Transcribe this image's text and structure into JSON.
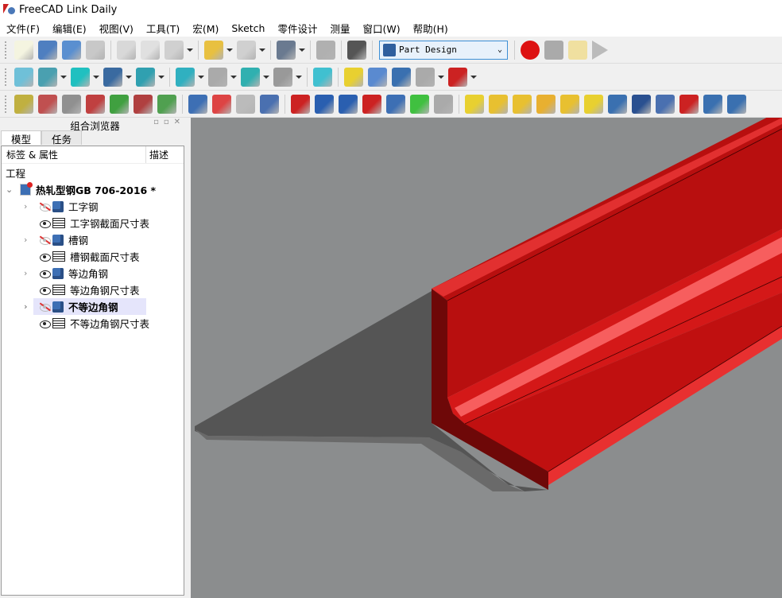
{
  "window": {
    "title": "FreeCAD Link Daily"
  },
  "menu": [
    "文件(F)",
    "编辑(E)",
    "视图(V)",
    "工具(T)",
    "宏(M)",
    "Sketch",
    "零件设计",
    "测量",
    "窗口(W)",
    "帮助(H)"
  ],
  "toolbar1": {
    "icons": [
      {
        "name": "new-file-icon",
        "color": "#f4f4e0"
      },
      {
        "name": "open-folder-icon",
        "color": "#4f7fc0"
      },
      {
        "name": "save-icon",
        "color": "#5a8fd0"
      },
      {
        "name": "print-icon",
        "color": "#c8c8c8"
      },
      {
        "name": "cut-icon",
        "color": "#d8d8d8"
      },
      {
        "name": "copy-icon",
        "color": "#e0e0e0"
      },
      {
        "name": "paste-icon",
        "color": "#d0d0d0"
      },
      {
        "name": "undo-icon",
        "color": "#e8c040"
      },
      {
        "name": "redo-icon",
        "color": "#d0d0d0"
      },
      {
        "name": "refresh-check-icon",
        "color": "#6a7a90"
      },
      {
        "name": "recompute-icon",
        "color": "#b0b0b0"
      },
      {
        "name": "whats-this-icon",
        "color": "#555"
      }
    ],
    "workbench": "Part Design",
    "macro_icons": [
      {
        "name": "record-macro-icon",
        "color": "#dd1111"
      },
      {
        "name": "stop-macro-icon",
        "color": "#aaaaaa"
      },
      {
        "name": "edit-macro-icon",
        "color": "#f0e0a0"
      },
      {
        "name": "run-macro-icon",
        "color": "#bbbbbb"
      }
    ]
  },
  "toolbar2": {
    "icons": [
      {
        "name": "fit-all-icon",
        "color": "#6fc0d8"
      },
      {
        "name": "isometric-view-icon",
        "color": "#4aa0b0"
      },
      {
        "name": "draw-style-icon",
        "color": "#20c0c0"
      },
      {
        "name": "box-selection-icon",
        "color": "#3a6aa0"
      },
      {
        "name": "zoom-selection-icon",
        "color": "#30a0b0"
      },
      {
        "name": "back-icon",
        "color": "#30b0c0"
      },
      {
        "name": "forward-icon",
        "color": "#aaaaaa"
      },
      {
        "name": "up-icon",
        "color": "#30b0b0"
      },
      {
        "name": "std-views-icon",
        "color": "#999999"
      },
      {
        "name": "measure-ruler-icon",
        "color": "#40c0d0"
      },
      {
        "name": "part-icon",
        "color": "#e8d030"
      },
      {
        "name": "group-icon",
        "color": "#5a8ad0"
      },
      {
        "name": "link-icon",
        "color": "#3a70b0"
      },
      {
        "name": "link-actions-icon",
        "color": "#aaaaaa"
      },
      {
        "name": "axis-cross-icon",
        "color": "#cc2222"
      }
    ]
  },
  "toolbar3": {
    "icons": [
      {
        "name": "measure-linear-icon",
        "color": "#c0b040"
      },
      {
        "name": "measure-angular-icon",
        "color": "#c05050"
      },
      {
        "name": "measure-refresh-icon",
        "color": "#909090"
      },
      {
        "name": "measure-clear-icon",
        "color": "#c04040"
      },
      {
        "name": "measure-toggle-icon",
        "color": "#40a040"
      },
      {
        "name": "measure-toggle-3d-icon",
        "color": "#b04040"
      },
      {
        "name": "measure-toggle-delta-icon",
        "color": "#50a050"
      },
      {
        "name": "create-body-icon",
        "color": "#3d6fb4"
      },
      {
        "name": "create-sketch-icon",
        "color": "#dd4444"
      },
      {
        "name": "validate-sketch-icon",
        "color": "#bbbbbb"
      },
      {
        "name": "map-sketch-icon",
        "color": "#4a70b0"
      },
      {
        "name": "datum-point-icon",
        "color": "#cc2222"
      },
      {
        "name": "datum-line-icon",
        "color": "#2a5fb0"
      },
      {
        "name": "datum-plane-icon",
        "color": "#2a5fb0"
      },
      {
        "name": "local-cs-icon",
        "color": "#cc2222"
      },
      {
        "name": "shape-binder-icon",
        "color": "#3d6fb4"
      },
      {
        "name": "subshape-binder-icon",
        "color": "#40c040"
      },
      {
        "name": "clone-icon",
        "color": "#aaaaaa"
      },
      {
        "name": "pad-icon",
        "color": "#e8d030"
      },
      {
        "name": "revolution-icon",
        "color": "#e8c030"
      },
      {
        "name": "additive-loft-icon",
        "color": "#e8c030"
      },
      {
        "name": "additive-pipe-icon",
        "color": "#e8b030"
      },
      {
        "name": "additive-helix-icon",
        "color": "#e8c030"
      },
      {
        "name": "additive-primitive-icon",
        "color": "#e8d030"
      },
      {
        "name": "pocket-icon",
        "color": "#3a70b0"
      },
      {
        "name": "hole-icon",
        "color": "#2a5090"
      },
      {
        "name": "groove-icon",
        "color": "#4a70b0"
      },
      {
        "name": "subtractive-loft-icon",
        "color": "#cc2222"
      },
      {
        "name": "subtractive-pipe-icon",
        "color": "#3a70b0"
      },
      {
        "name": "subtractive-helix-icon",
        "color": "#3a70b0"
      }
    ]
  },
  "combo_view": {
    "title": "组合浏览器",
    "tabs": [
      "模型",
      "任务"
    ],
    "columns": [
      "标签 & 属性",
      "描述"
    ],
    "section": "工程",
    "document": "热轧型钢GB 706-2016 *",
    "items": [
      {
        "label": "工字钢",
        "type": "body",
        "visible": false,
        "expandable": true,
        "bold": false
      },
      {
        "label": "工字钢截面尺寸表",
        "type": "spreadsheet",
        "visible": true,
        "expandable": false,
        "bold": false
      },
      {
        "label": "槽钢",
        "type": "body",
        "visible": false,
        "expandable": true,
        "bold": false
      },
      {
        "label": "槽钢截面尺寸表",
        "type": "spreadsheet",
        "visible": true,
        "expandable": false,
        "bold": false
      },
      {
        "label": "等边角钢",
        "type": "body",
        "visible": true,
        "expandable": true,
        "bold": false
      },
      {
        "label": "等边角钢尺寸表",
        "type": "spreadsheet",
        "visible": true,
        "expandable": false,
        "bold": false
      },
      {
        "label": "不等边角钢",
        "type": "body",
        "visible": false,
        "expandable": true,
        "bold": true,
        "selected": true
      },
      {
        "label": "不等边角钢尺寸表",
        "type": "spreadsheet",
        "visible": true,
        "expandable": false,
        "bold": false
      }
    ]
  },
  "viewport": {
    "background": "#8b8d8e",
    "model_color": "#c41414"
  }
}
